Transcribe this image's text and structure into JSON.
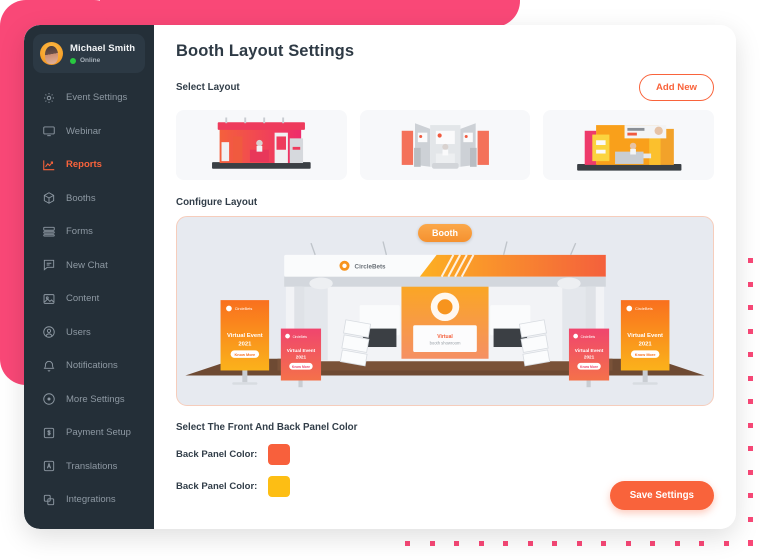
{
  "sidebar": {
    "profile": {
      "name": "Michael Smith",
      "status": "Online",
      "status_color": "#28C840",
      "avatar_icon": "user-avatar"
    },
    "items": [
      {
        "label": "Event Settings",
        "icon": "gear-icon",
        "active": false
      },
      {
        "label": "Webinar",
        "icon": "monitor-icon",
        "active": false
      },
      {
        "label": "Reports",
        "icon": "chart-line-icon",
        "active": true
      },
      {
        "label": "Booths",
        "icon": "cube-icon",
        "active": false
      },
      {
        "label": "Forms",
        "icon": "forms-icon",
        "active": false
      },
      {
        "label": "New Chat",
        "icon": "chat-icon",
        "active": false
      },
      {
        "label": "Content",
        "icon": "image-icon",
        "active": false
      },
      {
        "label": "Users",
        "icon": "user-circle-icon",
        "active": false
      },
      {
        "label": "Notifications",
        "icon": "bell-icon",
        "active": false
      },
      {
        "label": "More Settings",
        "icon": "dot-circle-icon",
        "active": false
      },
      {
        "label": "Payment Setup",
        "icon": "dollar-square-icon",
        "active": false
      },
      {
        "label": "Translations",
        "icon": "letter-square-icon",
        "active": false
      },
      {
        "label": "Integrations",
        "icon": "copy-icon",
        "active": false
      }
    ]
  },
  "main": {
    "title": "Booth Layout Settings",
    "select_layout_label": "Select Layout",
    "add_new_label": "Add New",
    "layouts": [
      {
        "name": "red-booth-layout",
        "selected": false
      },
      {
        "name": "gray-booth-layout",
        "selected": false
      },
      {
        "name": "yellow-booth-layout",
        "selected": false
      }
    ],
    "configure_layout_label": "Configure Layout",
    "booth_badge": "Booth",
    "preview": {
      "logo_text": "CircleBets",
      "banner_heading": "Virtual Event",
      "banner_year": "2021",
      "banner_button": "Know More",
      "screen_text": "Visit booth"
    },
    "panel_color_title": "Select The Front And Back Panel Color",
    "color_rows": [
      {
        "label": "Back Panel Color:",
        "value": "#F8603C"
      },
      {
        "label": "Back Panel Color:",
        "value": "#FDBE14"
      }
    ],
    "save_label": "Save Settings"
  },
  "theme": {
    "accent": "#F9633B",
    "pink": "#F94877",
    "sidebar_bg": "#242F38"
  }
}
